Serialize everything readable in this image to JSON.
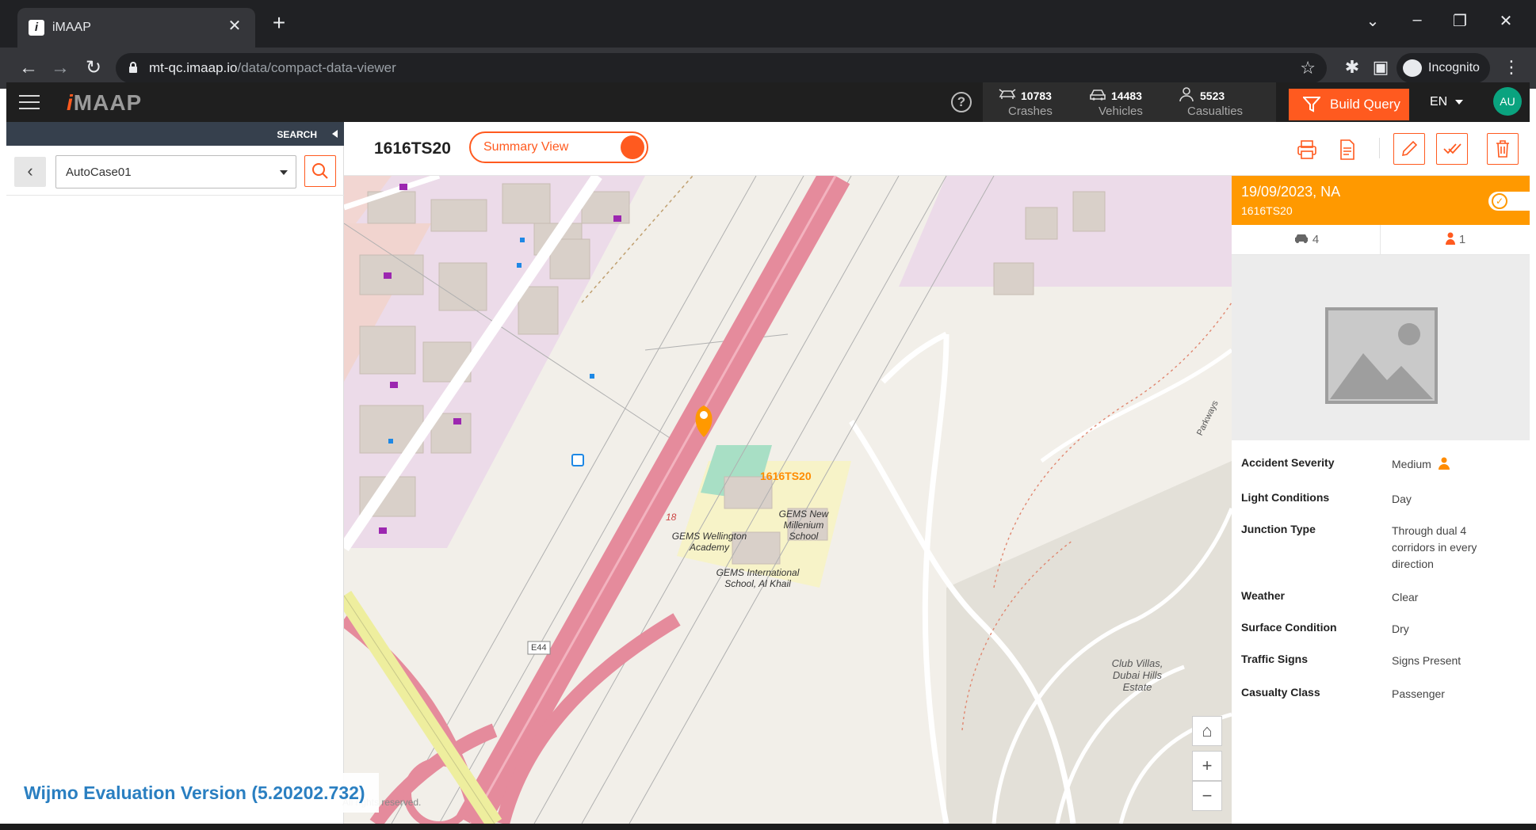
{
  "browser": {
    "tab_title": "iMAAP",
    "tab_favicon": "i",
    "url_host": "mt-qc.imaap.io",
    "url_path": "/data/compact-data-viewer",
    "incognito_label": "Incognito"
  },
  "header": {
    "logo_prefix": "i",
    "logo_rest": "MAAP",
    "stats": [
      {
        "icon": "crash-icon",
        "value": "10783",
        "label": "Crashes"
      },
      {
        "icon": "car-icon",
        "value": "14483",
        "label": "Vehicles"
      },
      {
        "icon": "person-icon",
        "value": "5523",
        "label": "Casualties"
      }
    ],
    "build_query_label": "Build Query",
    "language": "EN",
    "avatar_initials": "AU",
    "colors": {
      "accent": "#ff5a1f",
      "header_bg": "#1f1f1f",
      "avatar": "#0aa37f"
    }
  },
  "left_panel": {
    "search_label": "SEARCH",
    "case_select_value": "AutoCase01"
  },
  "toolbar": {
    "case_id": "1616TS20",
    "view_toggle_label": "Summary View"
  },
  "map": {
    "marker_label": "1616TS20",
    "route_shield": "E44",
    "road_number": "18",
    "labels": {
      "school1": "GEMS Wellington Academy",
      "school2": "GEMS New Millenium School",
      "school3": "GEMS International School, Al Khail",
      "estate": "Club Villas, Dubai Hills Estate",
      "parkways": "Parkways"
    },
    "copyright": "All rights reserved."
  },
  "detail": {
    "date": "19/09/2023, NA",
    "case_id": "1616TS20",
    "vehicle_count": "4",
    "casualty_count": "1",
    "header_color": "#ff9900",
    "attributes": [
      {
        "label": "Accident Severity",
        "value": "Medium"
      },
      {
        "label": "Light Conditions",
        "value": "Day"
      },
      {
        "label": "Junction Type",
        "value": "Through dual 4 corridors in every direction"
      },
      {
        "label": "Weather",
        "value": "Clear"
      },
      {
        "label": "Surface Condition",
        "value": "Dry"
      },
      {
        "label": "Traffic Signs",
        "value": "Signs Present"
      },
      {
        "label": "Casualty Class",
        "value": "Passenger"
      }
    ]
  },
  "watermark": "Wijmo Evaluation Version (5.20202.732)"
}
